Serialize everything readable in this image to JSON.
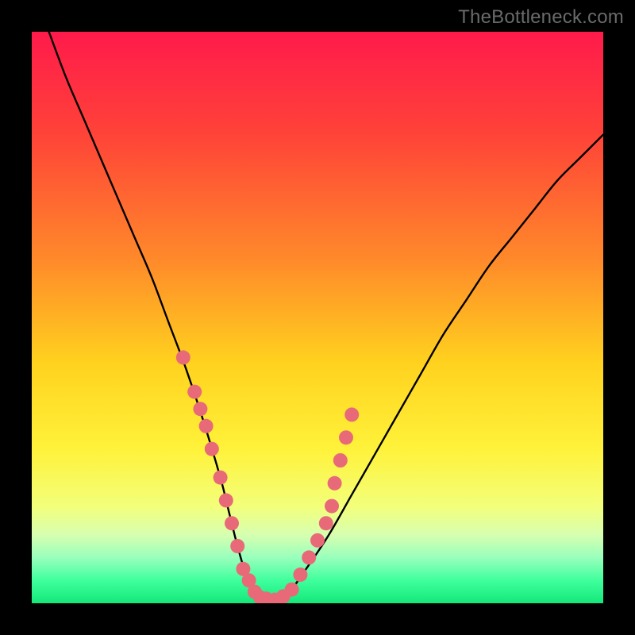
{
  "watermark": "TheBottleneck.com",
  "chart_data": {
    "type": "line",
    "title": "",
    "xlabel": "",
    "ylabel": "",
    "xlim": [
      0,
      100
    ],
    "ylim": [
      0,
      100
    ],
    "series": [
      {
        "name": "curve",
        "x": [
          3,
          6,
          9,
          12,
          15,
          18,
          21,
          24,
          27,
          30,
          33,
          34.5,
          36,
          37.5,
          39,
          42,
          45,
          48,
          52,
          56,
          60,
          64,
          68,
          72,
          76,
          80,
          84,
          88,
          92,
          96,
          100
        ],
        "y": [
          100,
          92,
          85,
          78,
          71,
          64,
          57,
          49,
          41,
          32,
          22,
          16,
          10,
          5,
          2,
          0.5,
          2,
          6,
          12,
          19,
          26,
          33,
          40,
          47,
          53,
          59,
          64,
          69,
          74,
          78,
          82
        ]
      },
      {
        "name": "markers",
        "x": [
          26.5,
          28.5,
          29.5,
          30.5,
          31.5,
          33.0,
          34.0,
          35.0,
          36.0,
          37.0,
          38.0,
          39.0,
          40.0,
          41.0,
          42.5,
          44.0,
          45.5,
          47.0,
          48.5,
          50.0,
          51.5,
          52.5,
          53.0,
          54.0,
          55.0,
          56.0
        ],
        "y": [
          43,
          37,
          34,
          31,
          27,
          22,
          18,
          14,
          10,
          6,
          4,
          2,
          1,
          0.8,
          0.6,
          1.2,
          2.4,
          5,
          8,
          11,
          14,
          17,
          21,
          25,
          29,
          33
        ]
      }
    ],
    "gradient_stops": [
      {
        "pos": 0.0,
        "color": "#ff1a4b"
      },
      {
        "pos": 0.18,
        "color": "#ff4338"
      },
      {
        "pos": 0.4,
        "color": "#ff8a2a"
      },
      {
        "pos": 0.58,
        "color": "#ffd21e"
      },
      {
        "pos": 0.73,
        "color": "#fff23a"
      },
      {
        "pos": 0.83,
        "color": "#f3ff7a"
      },
      {
        "pos": 0.88,
        "color": "#d7ffb0"
      },
      {
        "pos": 0.92,
        "color": "#99ffbc"
      },
      {
        "pos": 0.96,
        "color": "#3fff9d"
      },
      {
        "pos": 1.0,
        "color": "#14e87a"
      }
    ],
    "marker_color": "#e86a78",
    "curve_color": "#000000"
  }
}
